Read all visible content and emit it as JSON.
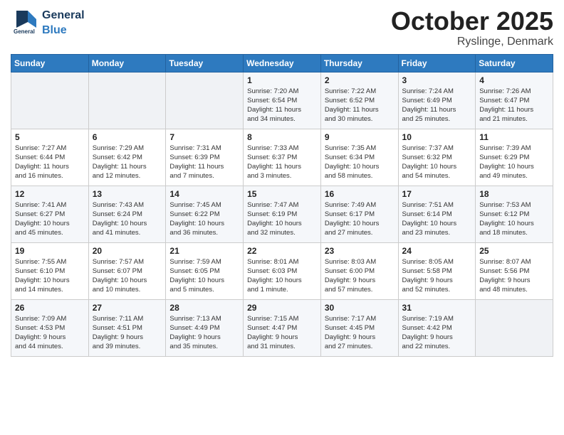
{
  "header": {
    "logo": {
      "text_general": "General",
      "text_blue": "Blue"
    },
    "month": "October 2025",
    "location": "Ryslinge, Denmark"
  },
  "weekdays": [
    "Sunday",
    "Monday",
    "Tuesday",
    "Wednesday",
    "Thursday",
    "Friday",
    "Saturday"
  ],
  "weeks": [
    [
      {
        "day": "",
        "info": ""
      },
      {
        "day": "",
        "info": ""
      },
      {
        "day": "",
        "info": ""
      },
      {
        "day": "1",
        "info": "Sunrise: 7:20 AM\nSunset: 6:54 PM\nDaylight: 11 hours\nand 34 minutes."
      },
      {
        "day": "2",
        "info": "Sunrise: 7:22 AM\nSunset: 6:52 PM\nDaylight: 11 hours\nand 30 minutes."
      },
      {
        "day": "3",
        "info": "Sunrise: 7:24 AM\nSunset: 6:49 PM\nDaylight: 11 hours\nand 25 minutes."
      },
      {
        "day": "4",
        "info": "Sunrise: 7:26 AM\nSunset: 6:47 PM\nDaylight: 11 hours\nand 21 minutes."
      }
    ],
    [
      {
        "day": "5",
        "info": "Sunrise: 7:27 AM\nSunset: 6:44 PM\nDaylight: 11 hours\nand 16 minutes."
      },
      {
        "day": "6",
        "info": "Sunrise: 7:29 AM\nSunset: 6:42 PM\nDaylight: 11 hours\nand 12 minutes."
      },
      {
        "day": "7",
        "info": "Sunrise: 7:31 AM\nSunset: 6:39 PM\nDaylight: 11 hours\nand 7 minutes."
      },
      {
        "day": "8",
        "info": "Sunrise: 7:33 AM\nSunset: 6:37 PM\nDaylight: 11 hours\nand 3 minutes."
      },
      {
        "day": "9",
        "info": "Sunrise: 7:35 AM\nSunset: 6:34 PM\nDaylight: 10 hours\nand 58 minutes."
      },
      {
        "day": "10",
        "info": "Sunrise: 7:37 AM\nSunset: 6:32 PM\nDaylight: 10 hours\nand 54 minutes."
      },
      {
        "day": "11",
        "info": "Sunrise: 7:39 AM\nSunset: 6:29 PM\nDaylight: 10 hours\nand 49 minutes."
      }
    ],
    [
      {
        "day": "12",
        "info": "Sunrise: 7:41 AM\nSunset: 6:27 PM\nDaylight: 10 hours\nand 45 minutes."
      },
      {
        "day": "13",
        "info": "Sunrise: 7:43 AM\nSunset: 6:24 PM\nDaylight: 10 hours\nand 41 minutes."
      },
      {
        "day": "14",
        "info": "Sunrise: 7:45 AM\nSunset: 6:22 PM\nDaylight: 10 hours\nand 36 minutes."
      },
      {
        "day": "15",
        "info": "Sunrise: 7:47 AM\nSunset: 6:19 PM\nDaylight: 10 hours\nand 32 minutes."
      },
      {
        "day": "16",
        "info": "Sunrise: 7:49 AM\nSunset: 6:17 PM\nDaylight: 10 hours\nand 27 minutes."
      },
      {
        "day": "17",
        "info": "Sunrise: 7:51 AM\nSunset: 6:14 PM\nDaylight: 10 hours\nand 23 minutes."
      },
      {
        "day": "18",
        "info": "Sunrise: 7:53 AM\nSunset: 6:12 PM\nDaylight: 10 hours\nand 18 minutes."
      }
    ],
    [
      {
        "day": "19",
        "info": "Sunrise: 7:55 AM\nSunset: 6:10 PM\nDaylight: 10 hours\nand 14 minutes."
      },
      {
        "day": "20",
        "info": "Sunrise: 7:57 AM\nSunset: 6:07 PM\nDaylight: 10 hours\nand 10 minutes."
      },
      {
        "day": "21",
        "info": "Sunrise: 7:59 AM\nSunset: 6:05 PM\nDaylight: 10 hours\nand 5 minutes."
      },
      {
        "day": "22",
        "info": "Sunrise: 8:01 AM\nSunset: 6:03 PM\nDaylight: 10 hours\nand 1 minute."
      },
      {
        "day": "23",
        "info": "Sunrise: 8:03 AM\nSunset: 6:00 PM\nDaylight: 9 hours\nand 57 minutes."
      },
      {
        "day": "24",
        "info": "Sunrise: 8:05 AM\nSunset: 5:58 PM\nDaylight: 9 hours\nand 52 minutes."
      },
      {
        "day": "25",
        "info": "Sunrise: 8:07 AM\nSunset: 5:56 PM\nDaylight: 9 hours\nand 48 minutes."
      }
    ],
    [
      {
        "day": "26",
        "info": "Sunrise: 7:09 AM\nSunset: 4:53 PM\nDaylight: 9 hours\nand 44 minutes."
      },
      {
        "day": "27",
        "info": "Sunrise: 7:11 AM\nSunset: 4:51 PM\nDaylight: 9 hours\nand 39 minutes."
      },
      {
        "day": "28",
        "info": "Sunrise: 7:13 AM\nSunset: 4:49 PM\nDaylight: 9 hours\nand 35 minutes."
      },
      {
        "day": "29",
        "info": "Sunrise: 7:15 AM\nSunset: 4:47 PM\nDaylight: 9 hours\nand 31 minutes."
      },
      {
        "day": "30",
        "info": "Sunrise: 7:17 AM\nSunset: 4:45 PM\nDaylight: 9 hours\nand 27 minutes."
      },
      {
        "day": "31",
        "info": "Sunrise: 7:19 AM\nSunset: 4:42 PM\nDaylight: 9 hours\nand 22 minutes."
      },
      {
        "day": "",
        "info": ""
      }
    ]
  ]
}
